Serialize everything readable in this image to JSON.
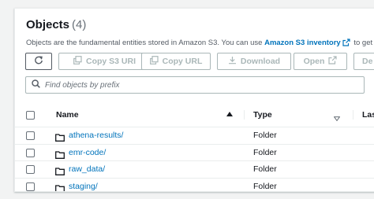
{
  "panel": {
    "title": "Objects",
    "count": "(4)",
    "description_prefix": "Objects are the fundamental entities stored in Amazon S3. You can use",
    "description_link": "Amazon S3 inventory",
    "description_suffix": "to get a list of all ob"
  },
  "toolbar": {
    "copy_s3_uri": "Copy S3 URI",
    "copy_url": "Copy URL",
    "download": "Download",
    "open": "Open",
    "delete_partial": "De"
  },
  "search": {
    "placeholder": "Find objects by prefix",
    "value": ""
  },
  "table": {
    "columns": [
      "Name",
      "Type",
      "Las"
    ],
    "rows": [
      {
        "name": "athena-results/",
        "type": "Folder"
      },
      {
        "name": "emr-code/",
        "type": "Folder"
      },
      {
        "name": "raw_data/",
        "type": "Folder"
      },
      {
        "name": "staging/",
        "type": "Folder"
      }
    ]
  },
  "icons": [
    "refresh-icon",
    "copy-icon",
    "download-icon",
    "external-link-icon",
    "search-icon",
    "folder-icon",
    "sort-ascending-icon",
    "sort-descending-icon"
  ],
  "colors": {
    "link": "#0073bb",
    "text": "#16191f",
    "muted": "#545b64",
    "disabled": "#aab7b8",
    "background": "#f2f3f3"
  }
}
